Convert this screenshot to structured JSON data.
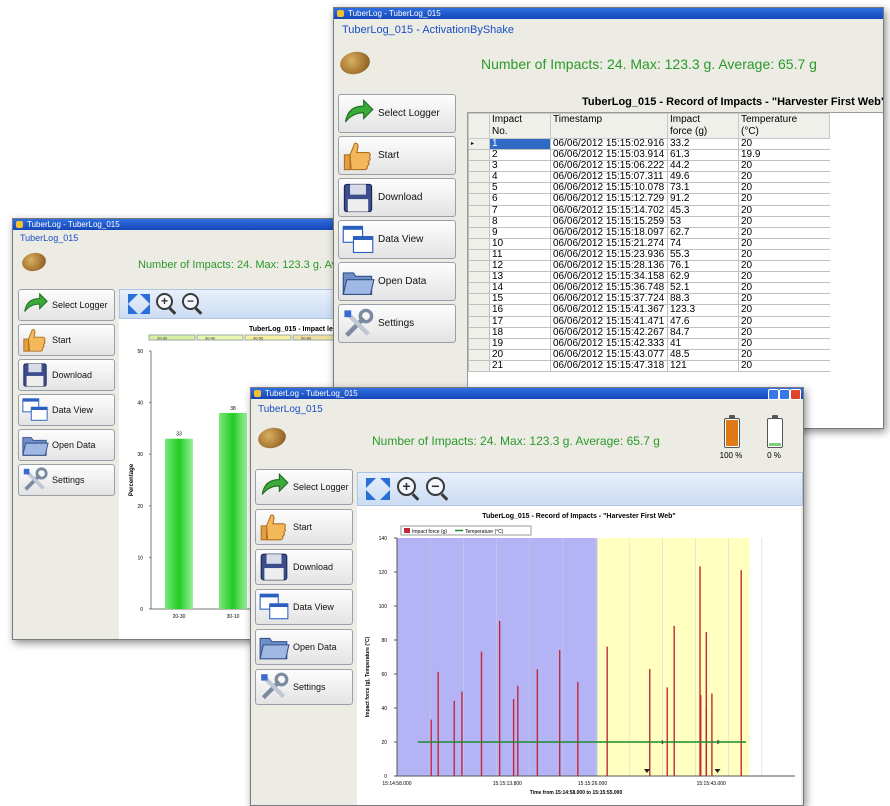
{
  "window_title": "TuberLog - TuberLog_015",
  "window_back": {
    "subtitle": "TuberLog_015"
  },
  "window_top": {
    "subtitle": "TuberLog_015 - ActivationByShake"
  },
  "window_front": {
    "subtitle": "TuberLog_015"
  },
  "summary": "Number of Impacts: 24. Max: 123.3 g. Average: 65.7 g",
  "summary_back_clipped": "Number of Impacts: 24. Max: 123.3 g. Avera",
  "nav": [
    {
      "label": "Select Logger",
      "icon": "green-arrow-icon"
    },
    {
      "label": "Start",
      "icon": "thumbs-up-icon"
    },
    {
      "label": "Download",
      "icon": "floppy-disk-icon"
    },
    {
      "label": "Data View",
      "icon": "windows-icon"
    },
    {
      "label": "Open Data",
      "icon": "folder-icon"
    },
    {
      "label": "Settings",
      "icon": "tools-icon"
    }
  ],
  "record_table": {
    "title": "TuberLog_015 - Record of Impacts - \"Harvester First Web\"",
    "columns": [
      "Impact No.",
      "Timestamp",
      "Impact force (g)",
      "Temperature (°C)"
    ],
    "column_lines": [
      [
        "Impact",
        "No."
      ],
      [
        "Timestamp",
        ""
      ],
      [
        "Impact",
        "force (g)"
      ],
      [
        "Temperature",
        "(°C)"
      ]
    ],
    "row_pointer": "▸",
    "rows": [
      [
        "1",
        "06/06/2012 15:15:02.916",
        "33.2",
        "20"
      ],
      [
        "2",
        "06/06/2012 15:15:03.914",
        "61.3",
        "19.9"
      ],
      [
        "3",
        "06/06/2012 15:15:06.222",
        "44.2",
        "20"
      ],
      [
        "4",
        "06/06/2012 15:15:07.311",
        "49.6",
        "20"
      ],
      [
        "5",
        "06/06/2012 15:15:10.078",
        "73.1",
        "20"
      ],
      [
        "6",
        "06/06/2012 15:15:12.729",
        "91.2",
        "20"
      ],
      [
        "7",
        "06/06/2012 15:15:14.702",
        "45.3",
        "20"
      ],
      [
        "8",
        "06/06/2012 15:15:15.259",
        "53",
        "20"
      ],
      [
        "9",
        "06/06/2012 15:15:18.097",
        "62.7",
        "20"
      ],
      [
        "10",
        "06/06/2012 15:15:21.274",
        "74",
        "20"
      ],
      [
        "11",
        "06/06/2012 15:15:23.936",
        "55.3",
        "20"
      ],
      [
        "12",
        "06/06/2012 15:15:28.136",
        "76.1",
        "20"
      ],
      [
        "13",
        "06/06/2012 15:15:34.158",
        "62.9",
        "20"
      ],
      [
        "14",
        "06/06/2012 15:15:36.748",
        "52.1",
        "20"
      ],
      [
        "15",
        "06/06/2012 15:15:37.724",
        "88.3",
        "20"
      ],
      [
        "16",
        "06/06/2012 15:15:41.367",
        "123.3",
        "20"
      ],
      [
        "17",
        "06/06/2012 15:15:41.471",
        "47.6",
        "20"
      ],
      [
        "18",
        "06/06/2012 15:15:42.267",
        "84.7",
        "20"
      ],
      [
        "19",
        "06/06/2012 15:15:42.333",
        "41",
        "20"
      ],
      [
        "20",
        "06/06/2012 15:15:43.077",
        "48.5",
        "20"
      ],
      [
        "21",
        "06/06/2012 15:15:47.318",
        "121",
        "20"
      ]
    ]
  },
  "batteries": [
    {
      "label": "100 %",
      "level": 1.0,
      "color": "#e07a18",
      "icon": "battery-full-icon"
    },
    {
      "label": "0 %",
      "level": 0.0,
      "color": "#7cd07c",
      "icon": "battery-empty-icon"
    }
  ],
  "chart_data": [
    {
      "type": "bar",
      "title": "TuberLog_015 - Impact le",
      "ylabel": "Percentage",
      "categories": [
        "20-30",
        "30-10"
      ],
      "values": [
        33,
        38
      ],
      "data_labels": [
        "33",
        "38"
      ],
      "ylim": [
        0,
        50
      ],
      "yticks": [
        "50",
        "40",
        "30",
        "20",
        "10",
        "0"
      ],
      "legend": [
        "20-30",
        "30-40",
        "40-50",
        "50-60"
      ],
      "color": "#3cd23c"
    },
    {
      "type": "bar",
      "title": "TuberLog_015 - Record of Impacts - \"Harvester First Web\"",
      "ylabel": "Impact force (g), Temperature (°C)",
      "xlabel": "Time from 15:14:58.000 to 15:15:55.000",
      "legend": [
        "Impact force (g)",
        "Temperature (°C)"
      ],
      "ylim": [
        0,
        140
      ],
      "yticks": [
        "140",
        "120",
        "100",
        "80",
        "60",
        "40",
        "20",
        "0"
      ],
      "xticks": [
        "15:14:58.000",
        "15:15:13.800",
        "15:15:26.000",
        "15:15:43.000"
      ],
      "x_seconds_range": [
        0,
        57
      ],
      "impact_color": "#c0283a",
      "temperature_color": "#1e8a2e",
      "temperature": 20,
      "regions": [
        {
          "from": 0,
          "to": 28.7,
          "color": "#b3b3f5"
        },
        {
          "from": 28.7,
          "to": 50.5,
          "color": "#ffffc0"
        }
      ],
      "impacts": [
        {
          "t": 4.9,
          "v": 33.2
        },
        {
          "t": 5.9,
          "v": 61.3
        },
        {
          "t": 8.2,
          "v": 44.2
        },
        {
          "t": 9.3,
          "v": 49.6
        },
        {
          "t": 12.1,
          "v": 73.1
        },
        {
          "t": 14.7,
          "v": 91.2
        },
        {
          "t": 16.7,
          "v": 45.3
        },
        {
          "t": 17.3,
          "v": 53
        },
        {
          "t": 20.1,
          "v": 62.7
        },
        {
          "t": 23.3,
          "v": 74
        },
        {
          "t": 25.9,
          "v": 55.3
        },
        {
          "t": 30.1,
          "v": 76.1
        },
        {
          "t": 36.2,
          "v": 62.9
        },
        {
          "t": 38.7,
          "v": 52.1
        },
        {
          "t": 39.7,
          "v": 88.3
        },
        {
          "t": 43.4,
          "v": 123.3
        },
        {
          "t": 43.5,
          "v": 47.6
        },
        {
          "t": 44.3,
          "v": 84.7
        },
        {
          "t": 44.3,
          "v": 41
        },
        {
          "t": 45.1,
          "v": 48.5
        },
        {
          "t": 49.3,
          "v": 121
        }
      ],
      "annotations": [
        "1",
        "2"
      ]
    }
  ]
}
